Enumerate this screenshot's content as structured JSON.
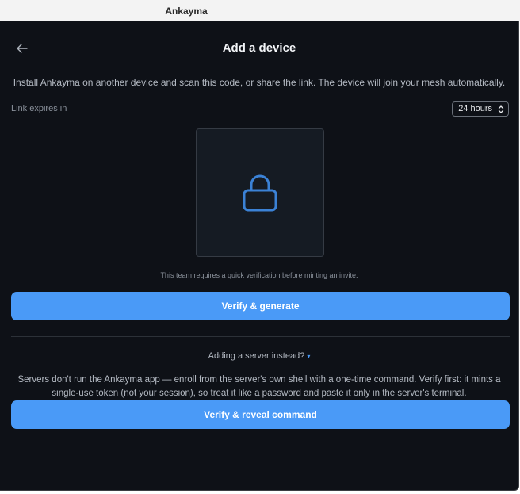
{
  "window": {
    "title": "Ankayma"
  },
  "header": {
    "title": "Add a device",
    "back_icon": "arrow-left-icon"
  },
  "intro": "Install Ankayma on another device and scan this code, or share the link. The device will join your mesh automatically.",
  "expiry": {
    "label": "Link expires in",
    "selected": "24 hours"
  },
  "qr": {
    "icon": "lock-icon",
    "accent": "#3b82d6"
  },
  "verification": {
    "note": "This team requires a quick verification before minting an invite.",
    "generate_label": "Verify & generate"
  },
  "server": {
    "toggle_label": "Adding a server instead?",
    "description": "Servers don't run the Ankayma app — enroll from the server's own shell with a one-time command. Verify first: it mints a single-use token (not your session), so treat it like a password and paste it only in the server's terminal.",
    "reveal_label": "Verify & reveal command"
  },
  "colors": {
    "primary": "#4a9af7",
    "background": "#0e1117"
  }
}
